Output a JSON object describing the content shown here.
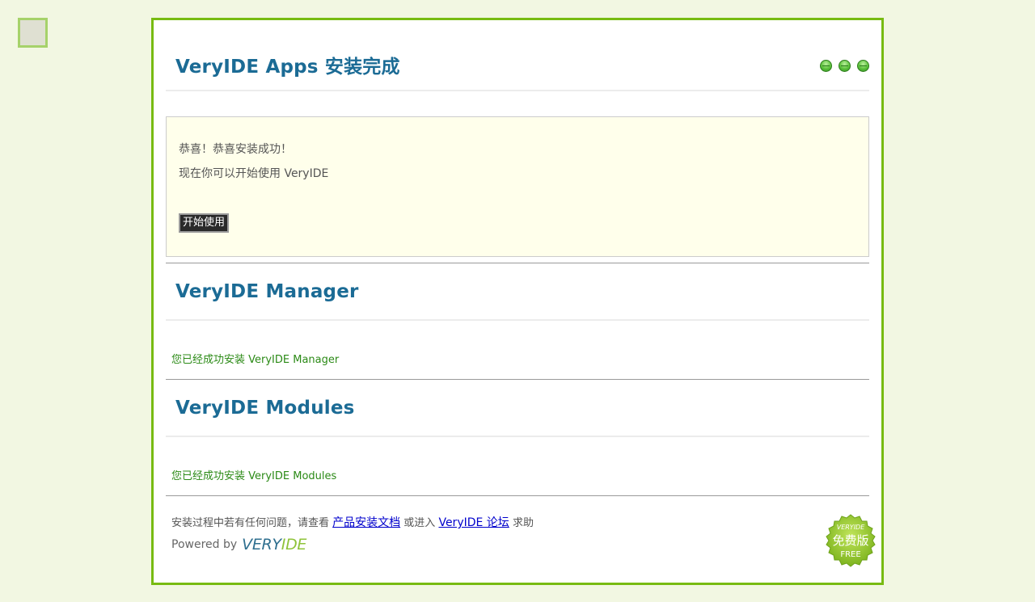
{
  "header": {
    "title": "VeryIDE Apps 安装完成"
  },
  "success_box": {
    "line1": "恭喜！恭喜安装成功！",
    "line2": "现在你可以开始使用 VeryIDE",
    "button_label": "开始使用"
  },
  "manager": {
    "title": "VeryIDE Manager",
    "message": "您已经成功安装 VeryIDE Manager"
  },
  "modules": {
    "title": "VeryIDE Modules",
    "message": "您已经成功安装 VeryIDE Modules"
  },
  "footer": {
    "text_before": "安装过程中若有任何问题，请查看",
    "docs_link": "产品安装文档",
    "text_middle": "或进入",
    "forum_link": "VeryIDE 论坛",
    "text_after": "求助",
    "powered_by": "Powered by",
    "logo_part1": "VERY",
    "logo_part2": "IDE"
  },
  "badge": {
    "top": "VERYIDE",
    "middle": "免费版",
    "bottom": "FREE"
  },
  "colors": {
    "page_bg": "#f2f7e2",
    "panel_border": "#78bb12",
    "title": "#1b6b95",
    "success_box_bg": "#ffffeb",
    "message": "#2b8a16",
    "link": "#0000cc"
  }
}
